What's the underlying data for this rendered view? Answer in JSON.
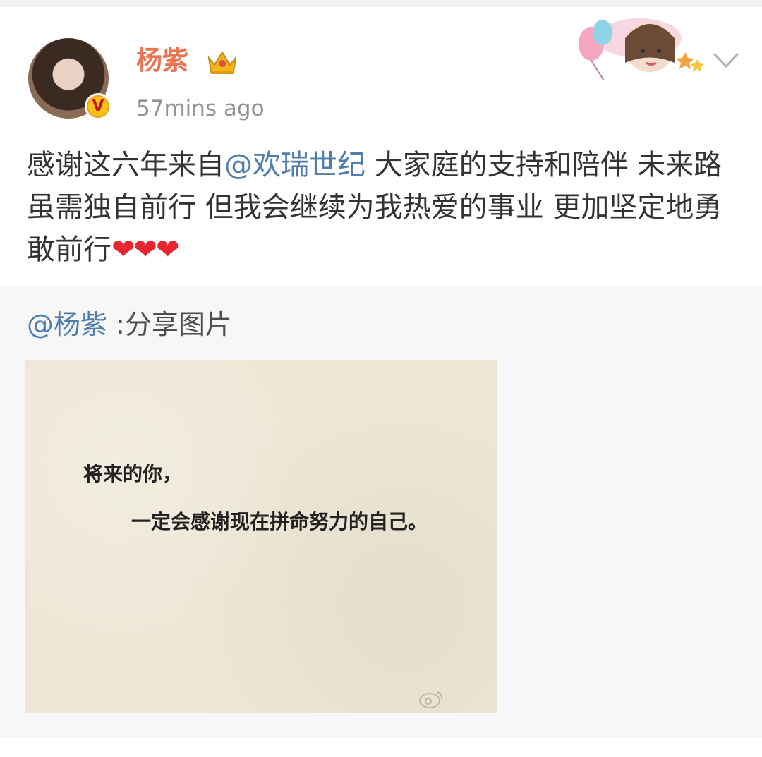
{
  "post": {
    "username": "杨紫",
    "timestamp": "57mins ago",
    "content": {
      "prefix": "感谢这六年来自",
      "mention": "@欢瑞世纪",
      "suffix": " 大家庭的支持和陪伴 未来路 虽需独自前行 但我会继续为我热爱的事业 更加坚定地勇敢前行",
      "hearts": "❤❤❤"
    },
    "verified_badge": "V"
  },
  "repost": {
    "mention": "@杨紫",
    "text": " :分享图片",
    "image": {
      "line1": "将来的你，",
      "line2": "一定会感谢现在拼命努力的自己。"
    }
  },
  "icons": [
    "crown-icon",
    "chevron-down-icon",
    "verified-icon",
    "weibo-watermark-icon"
  ]
}
